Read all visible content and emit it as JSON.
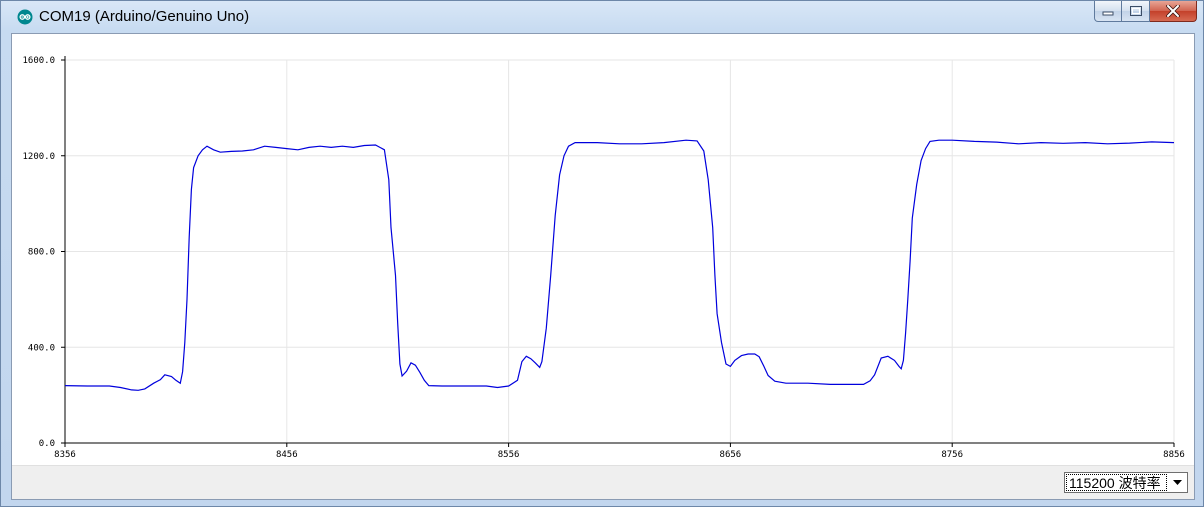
{
  "window": {
    "title": "COM19 (Arduino/Genuino Uno)",
    "app_icon": "arduino-icon",
    "buttons": [
      "minimize-icon",
      "maximize-icon",
      "close-icon"
    ]
  },
  "statusbar": {
    "baud_value": "115200 波特率",
    "baud_icon": "chevron-down-icon"
  },
  "colors": {
    "series": "#0000dd",
    "grid": "#e6e6e6",
    "plot_background": "#ffffff"
  },
  "chart_data": {
    "type": "line",
    "grid": true,
    "xlim": [
      8356,
      8856
    ],
    "ylim": [
      0,
      1600
    ],
    "x_ticks": [
      "8356",
      "8456",
      "8556",
      "8656",
      "8756",
      "8856"
    ],
    "y_ticks": [
      "1600.0",
      "1200.0",
      "800.0",
      "400.0",
      "0.0"
    ],
    "series": [
      {
        "color": "#0000dd",
        "points": [
          [
            8356,
            240
          ],
          [
            8366,
            238
          ],
          [
            8376,
            238
          ],
          [
            8381,
            232
          ],
          [
            8386,
            222
          ],
          [
            8389,
            220
          ],
          [
            8392,
            226
          ],
          [
            8396,
            250
          ],
          [
            8399,
            265
          ],
          [
            8401,
            285
          ],
          [
            8404,
            278
          ],
          [
            8406,
            262
          ],
          [
            8408,
            250
          ],
          [
            8409,
            298
          ],
          [
            8410,
            420
          ],
          [
            8411,
            600
          ],
          [
            8412,
            860
          ],
          [
            8413,
            1060
          ],
          [
            8414,
            1150
          ],
          [
            8416,
            1200
          ],
          [
            8418,
            1225
          ],
          [
            8420,
            1240
          ],
          [
            8423,
            1225
          ],
          [
            8426,
            1215
          ],
          [
            8431,
            1218
          ],
          [
            8436,
            1220
          ],
          [
            8441,
            1225
          ],
          [
            8446,
            1240
          ],
          [
            8451,
            1235
          ],
          [
            8456,
            1230
          ],
          [
            8461,
            1225
          ],
          [
            8466,
            1235
          ],
          [
            8471,
            1240
          ],
          [
            8476,
            1235
          ],
          [
            8481,
            1240
          ],
          [
            8486,
            1235
          ],
          [
            8491,
            1243
          ],
          [
            8496,
            1245
          ],
          [
            8500,
            1225
          ],
          [
            8502,
            1100
          ],
          [
            8503,
            900
          ],
          [
            8505,
            700
          ],
          [
            8506,
            500
          ],
          [
            8507,
            330
          ],
          [
            8508,
            280
          ],
          [
            8510,
            300
          ],
          [
            8512,
            335
          ],
          [
            8514,
            325
          ],
          [
            8516,
            295
          ],
          [
            8518,
            262
          ],
          [
            8520,
            240
          ],
          [
            8526,
            238
          ],
          [
            8536,
            238
          ],
          [
            8546,
            238
          ],
          [
            8551,
            232
          ],
          [
            8556,
            238
          ],
          [
            8560,
            262
          ],
          [
            8562,
            340
          ],
          [
            8564,
            362
          ],
          [
            8566,
            352
          ],
          [
            8568,
            335
          ],
          [
            8570,
            316
          ],
          [
            8571,
            340
          ],
          [
            8573,
            480
          ],
          [
            8575,
            700
          ],
          [
            8577,
            950
          ],
          [
            8579,
            1120
          ],
          [
            8581,
            1200
          ],
          [
            8583,
            1240
          ],
          [
            8586,
            1255
          ],
          [
            8596,
            1255
          ],
          [
            8606,
            1250
          ],
          [
            8616,
            1250
          ],
          [
            8626,
            1255
          ],
          [
            8636,
            1265
          ],
          [
            8641,
            1262
          ],
          [
            8644,
            1220
          ],
          [
            8646,
            1100
          ],
          [
            8648,
            900
          ],
          [
            8649,
            700
          ],
          [
            8650,
            540
          ],
          [
            8652,
            420
          ],
          [
            8654,
            330
          ],
          [
            8656,
            320
          ],
          [
            8658,
            345
          ],
          [
            8661,
            365
          ],
          [
            8664,
            372
          ],
          [
            8667,
            372
          ],
          [
            8669,
            360
          ],
          [
            8671,
            322
          ],
          [
            8673,
            282
          ],
          [
            8676,
            258
          ],
          [
            8681,
            250
          ],
          [
            8691,
            250
          ],
          [
            8701,
            245
          ],
          [
            8711,
            245
          ],
          [
            8716,
            245
          ],
          [
            8719,
            260
          ],
          [
            8721,
            285
          ],
          [
            8724,
            355
          ],
          [
            8727,
            362
          ],
          [
            8730,
            345
          ],
          [
            8732,
            320
          ],
          [
            8733,
            310
          ],
          [
            8734,
            345
          ],
          [
            8735,
            460
          ],
          [
            8736,
            600
          ],
          [
            8737,
            760
          ],
          [
            8738,
            940
          ],
          [
            8740,
            1080
          ],
          [
            8742,
            1180
          ],
          [
            8744,
            1230
          ],
          [
            8746,
            1260
          ],
          [
            8750,
            1265
          ],
          [
            8756,
            1265
          ],
          [
            8766,
            1260
          ],
          [
            8776,
            1257
          ],
          [
            8786,
            1250
          ],
          [
            8796,
            1255
          ],
          [
            8806,
            1252
          ],
          [
            8816,
            1255
          ],
          [
            8826,
            1250
          ],
          [
            8836,
            1253
          ],
          [
            8846,
            1258
          ],
          [
            8856,
            1255
          ]
        ]
      }
    ]
  }
}
